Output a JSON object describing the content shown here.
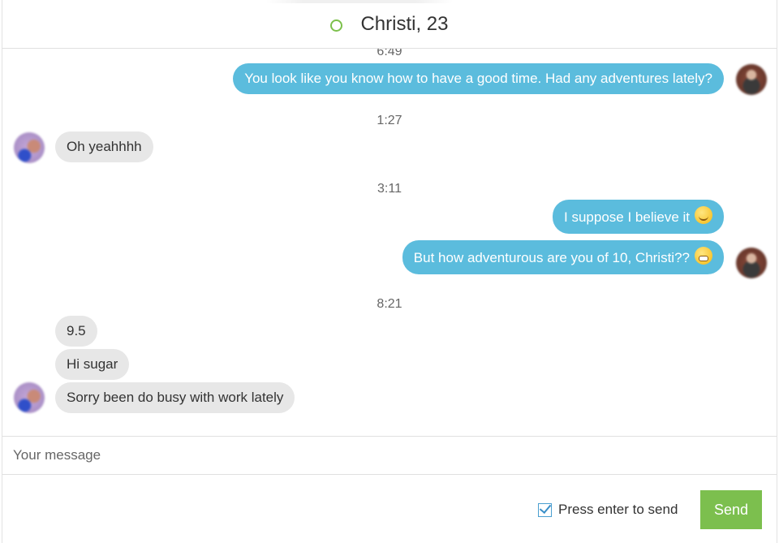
{
  "header": {
    "status": "online",
    "status_color": "#7cc04b",
    "title": "Christi, 23"
  },
  "thread": {
    "times": [
      "6:49",
      "1:27",
      "3:11",
      "8:21"
    ],
    "messages": [
      {
        "dir": "out",
        "text": "You look like you know how to have a good time. Had any adventures lately?"
      },
      {
        "dir": "in",
        "text": "Oh yeahhhh"
      },
      {
        "dir": "out",
        "text": "I suppose I believe it",
        "emoji": "smirking-face"
      },
      {
        "dir": "out",
        "text": "But how adventurous are you of 10, Christi??",
        "emoji": "grimacing-face"
      },
      {
        "dir": "in",
        "text": "9.5"
      },
      {
        "dir": "in",
        "text": "Hi sugar"
      },
      {
        "dir": "in",
        "text": "Sorry been do busy with work lately"
      }
    ]
  },
  "composer": {
    "placeholder": "Your message",
    "value": ""
  },
  "footer": {
    "press_enter_label": "Press enter to send",
    "press_enter_checked": true,
    "send_label": "Send"
  },
  "colors": {
    "outgoing_bubble": "#5bbcdd",
    "incoming_bubble": "#e7e7e7",
    "send_button": "#7cbf4e"
  }
}
